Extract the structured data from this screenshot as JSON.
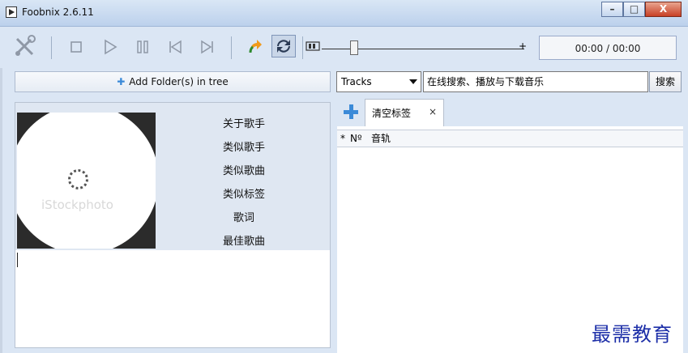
{
  "window": {
    "title": "Foobnix 2.6.11",
    "controls": {
      "minimize": "–",
      "maximize": "□",
      "close": "X"
    }
  },
  "toolbar": {
    "buttons": [
      {
        "icon": "settings-tools-icon"
      },
      {
        "icon": "stop-icon"
      },
      {
        "icon": "play-icon"
      },
      {
        "icon": "pause-icon"
      },
      {
        "icon": "previous-icon"
      },
      {
        "icon": "next-icon"
      },
      {
        "icon": "repeat-icon"
      },
      {
        "icon": "shuffle-icon"
      },
      {
        "icon": "volume-icon"
      }
    ],
    "plus_label": "+",
    "time": "00:00 / 00:00"
  },
  "left": {
    "add_folder_label": "Add Folder(s) in tree",
    "album_art_watermark": "iStockphoto",
    "info_menu": [
      "关于歌手",
      "类似歌手",
      "类似歌曲",
      "类似标签",
      "歌词",
      "最佳歌曲"
    ]
  },
  "search": {
    "scope_selected": "Tracks",
    "input_value": "在线搜索、播放与下载音乐",
    "button_label": "搜索"
  },
  "playlist": {
    "tab_label": "清空标签",
    "tab_close": "×",
    "columns": [
      "*",
      "Nº",
      "音轨"
    ]
  },
  "overlay": {
    "watermark_text": "最需教育"
  }
}
